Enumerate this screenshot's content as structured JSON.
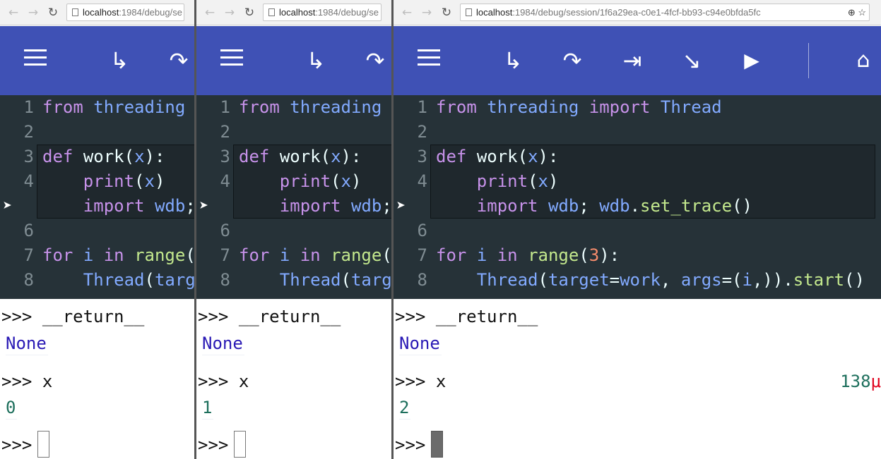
{
  "browser": {
    "host": "localhost",
    "path_short": ":1984/debug/se",
    "path_full": ":1984/debug/session/1f6a29ea-c0e1-4fcf-bb93-c94e0bfda5fc"
  },
  "toolbar": {
    "accent": "#3f51b5",
    "icons": [
      "menu-icon",
      "step-icon",
      "next-icon",
      "until-icon",
      "return-icon",
      "continue-icon",
      "home-icon"
    ]
  },
  "code": {
    "lines": [
      {
        "no": "1",
        "text": "from threading import Thread"
      },
      {
        "no": "2",
        "text": ""
      },
      {
        "no": "3",
        "text": "def work(x):"
      },
      {
        "no": "4",
        "text": "    print(x)"
      },
      {
        "no": "",
        "text": "    import wdb; wdb.set_trace()"
      },
      {
        "no": "6",
        "text": ""
      },
      {
        "no": "7",
        "text": "for i in range(3):"
      },
      {
        "no": "8",
        "text": "    Thread(target=work, args=(i,)).start()"
      }
    ],
    "current_marker": "➤"
  },
  "repl": {
    "prompt": ">>>",
    "cmd_return": "__return__",
    "return_value": "None",
    "cmd_x": "x"
  },
  "windows": [
    {
      "x_value": "0"
    },
    {
      "x_value": "1"
    },
    {
      "x_value": "2",
      "timing": "138",
      "timing_unit": "μ"
    }
  ]
}
